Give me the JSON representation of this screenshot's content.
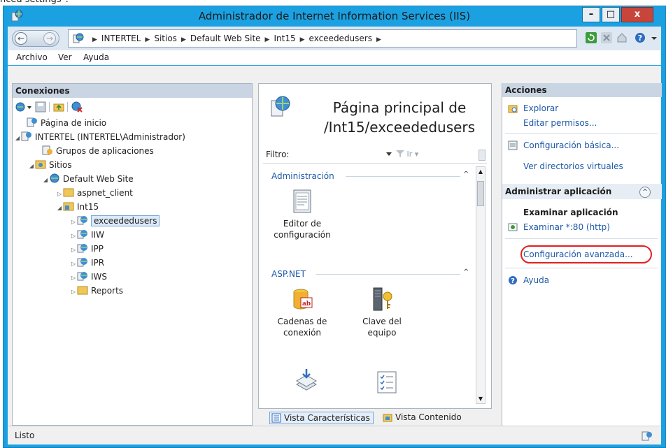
{
  "cutoff_caption": "nced settings\".",
  "window": {
    "title": "Administrador de Internet Information Services (IIS)",
    "buttons": {
      "minimize": "–",
      "maximize": "□",
      "close": "x"
    }
  },
  "address_bar": {
    "back_glyph": "←",
    "forward_glyph": "→",
    "breadcrumbs": [
      "INTERTEL",
      "Sitios",
      "Default Web Site",
      "Int15",
      "exceededusers"
    ],
    "separator": "▶",
    "tools": [
      "refresh-icon",
      "stop-icon",
      "home-icon",
      "help-icon"
    ]
  },
  "menu": [
    "Archivo",
    "Ver",
    "Ayuda"
  ],
  "connections": {
    "title": "Conexiones",
    "tree": [
      {
        "label": "Página de inicio",
        "icon": "server-icon",
        "expander": ""
      },
      {
        "label": "INTERTEL (INTERTEL\\Administrador)",
        "icon": "server-icon",
        "expander": "◢"
      },
      {
        "label": "Grupos de aplicaciones",
        "icon": "app-pool-icon",
        "expander": ""
      },
      {
        "label": "Sitios",
        "icon": "sites-folder-icon",
        "expander": "◢"
      },
      {
        "label": "Default Web Site",
        "icon": "globe-icon",
        "expander": "◢"
      },
      {
        "label": "aspnet_client",
        "icon": "folder-icon",
        "expander": "▷"
      },
      {
        "label": "Int15",
        "icon": "app-folder-icon",
        "expander": "◢"
      },
      {
        "label": "exceededusers",
        "icon": "web-app-icon",
        "expander": "▷"
      },
      {
        "label": "IIW",
        "icon": "web-app-icon",
        "expander": "▷"
      },
      {
        "label": "IPP",
        "icon": "web-app-icon",
        "expander": "▷"
      },
      {
        "label": "IPR",
        "icon": "web-app-icon",
        "expander": "▷"
      },
      {
        "label": "IWS",
        "icon": "web-app-icon",
        "expander": "▷"
      },
      {
        "label": "Reports",
        "icon": "folder-icon",
        "expander": "▷"
      }
    ]
  },
  "center": {
    "title_line1": "Página principal de",
    "title_line2": "/Int15/exceededusers",
    "filter_label": "Filtro:",
    "filter_go": "Ir",
    "sections": [
      {
        "title": "Administración",
        "caret": "^",
        "features": [
          {
            "label_line1": "Editor de",
            "label_line2": "configuración",
            "icon": "config-editor-icon"
          }
        ]
      },
      {
        "title": "ASP.NET",
        "caret": "^",
        "features": [
          {
            "label_line1": "Cadenas de",
            "label_line2": "conexión",
            "icon": "connection-strings-icon"
          },
          {
            "label_line1": "Clave del equipo",
            "label_line2": "",
            "icon": "machine-key-icon"
          }
        ]
      }
    ],
    "view_tabs": {
      "features": "Vista Características",
      "content": "Vista Contenido"
    }
  },
  "actions": {
    "title": "Acciones",
    "links_top": [
      "Explorar",
      "Editar permisos...",
      "Configuración básica...",
      "Ver directorios virtuales"
    ],
    "section_title": "Administrar aplicación",
    "section_toggle": "^",
    "subhead": "Examinar aplicación",
    "browse_link": "Examinar *:80 (http)",
    "advanced_link": "Configuración avanzada...",
    "help_link": "Ayuda"
  },
  "status": {
    "text": "Listo"
  },
  "colors": {
    "titlebar": "#1ba1e2",
    "link": "#1d5aa8",
    "pane_header": "#c9d5e2",
    "highlight_circle": "#e02020"
  }
}
